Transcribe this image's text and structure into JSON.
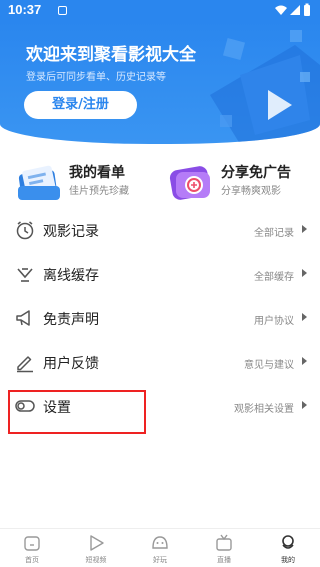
{
  "status_bar": {
    "time": "10:37"
  },
  "header": {
    "welcome": "欢迎来到聚看影视大全",
    "subtitle": "登录后可同步看单、历史记录等",
    "login_label": "登录/注册"
  },
  "quick_actions": [
    {
      "title": "我的看单",
      "desc": "佳片预先珍藏",
      "icon": "bookmark-list-icon"
    },
    {
      "title": "分享免广告",
      "desc": "分享畅爽观影",
      "icon": "share-coin-icon"
    }
  ],
  "menu": [
    {
      "label": "观影记录",
      "hint": "全部记录",
      "icon": "clock-icon"
    },
    {
      "label": "离线缓存",
      "hint": "全部缓存",
      "icon": "download-icon"
    },
    {
      "label": "免责声明",
      "hint": "用户协议",
      "icon": "megaphone-icon"
    },
    {
      "label": "用户反馈",
      "hint": "意见与建议",
      "icon": "pencil-icon"
    },
    {
      "label": "设置",
      "hint": "观影相关设置",
      "icon": "toggle-icon"
    }
  ],
  "tabbar": [
    {
      "label": "首页",
      "icon": "home-icon"
    },
    {
      "label": "短视频",
      "icon": "play-icon"
    },
    {
      "label": "好玩",
      "icon": "fun-icon"
    },
    {
      "label": "直播",
      "icon": "tv-icon"
    },
    {
      "label": "我的",
      "icon": "profile-icon",
      "active": true
    }
  ],
  "colors": {
    "brand": "#2a86ee",
    "annotation": "#ee2222"
  }
}
